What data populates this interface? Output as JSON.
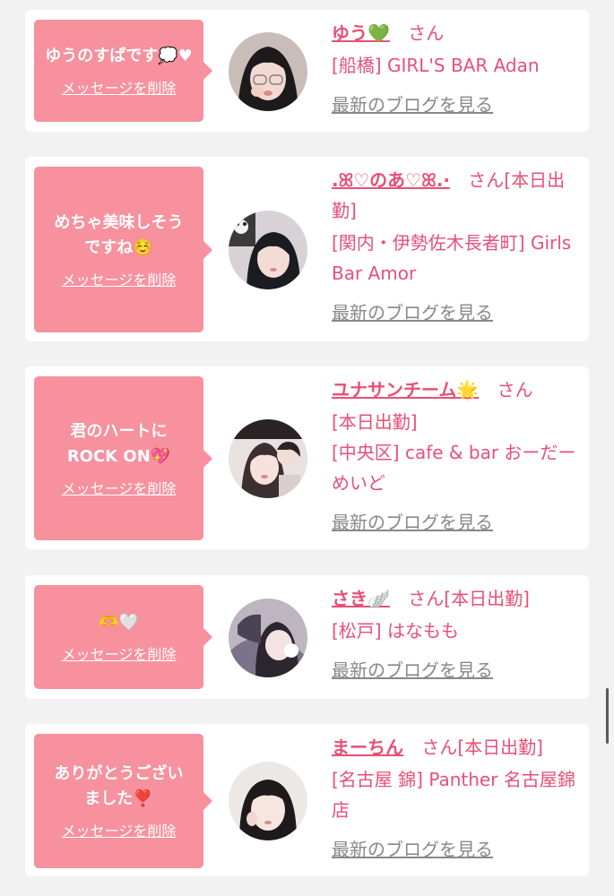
{
  "messages": [
    {
      "message": "ゆうのすぱです💭♥",
      "delete_label": "メッセージを削除",
      "name": "ゆう💚",
      "honorific": "さん",
      "status": "",
      "shop": "[船橋] GIRL'S BAR Adan",
      "blog_label": "最新のブログを見る"
    },
    {
      "message": "めちゃ美味しそうですね☺️",
      "delete_label": "メッセージを削除",
      "name": ".ꕤ♡のあ♡ꕤ.·",
      "honorific": "さん",
      "status": "[本日出勤]",
      "shop": "[関内・伊勢佐木長者町] Girls Bar Amor",
      "blog_label": "最新のブログを見る"
    },
    {
      "message": "君のハートにROCK ON💖",
      "delete_label": "メッセージを削除",
      "name": "ユナサンチーム🌟",
      "honorific": "さん",
      "status": "[本日出勤]",
      "shop": "[中央区] cafe & bar おーだーめいど",
      "blog_label": "最新のブログを見る"
    },
    {
      "message": "🫶🤍",
      "delete_label": "メッセージを削除",
      "name": "さき🪽",
      "honorific": "さん",
      "status": "[本日出勤]",
      "shop": "[松戸] はなもも",
      "blog_label": "最新のブログを見る"
    },
    {
      "message": "ありがとうございました❣️",
      "delete_label": "メッセージを削除",
      "name": "まーちん",
      "honorific": "さん",
      "status": "[本日出勤]",
      "shop": "[名古屋 錦] Panther 名古屋錦店",
      "blog_label": "最新のブログを見る"
    }
  ],
  "colors": {
    "bubble": "#f7919e",
    "accent_text": "#e84f76",
    "link_gray": "#888888",
    "page_bg": "#f2f2f2"
  }
}
